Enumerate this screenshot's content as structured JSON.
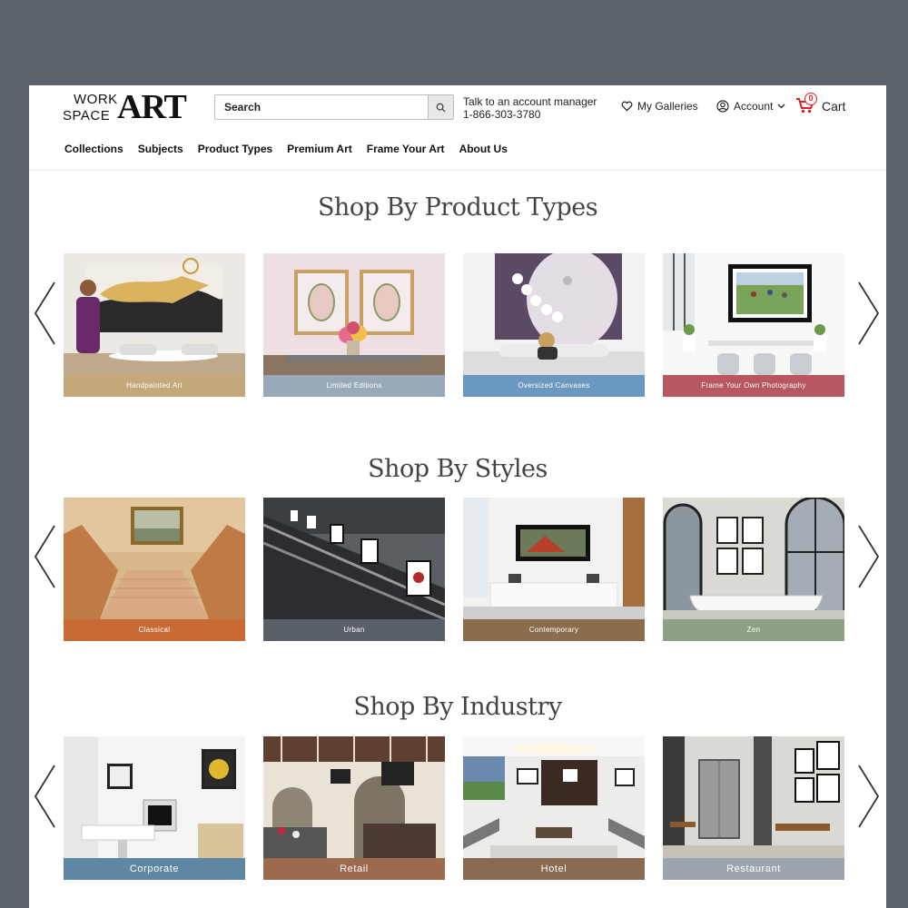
{
  "header": {
    "logo_work": "WORK",
    "logo_space": "SPACE",
    "logo_art": "ART",
    "search_placeholder": "Search",
    "contact_line1": "Talk to an account manager",
    "contact_line2": "1-866-303-3780",
    "galleries_label": "My Galleries",
    "account_label": "Account",
    "cart_label": "Cart",
    "cart_count": "0"
  },
  "nav": [
    "Collections",
    "Subjects",
    "Product Types",
    "Premium Art",
    "Frame Your Art",
    "About Us"
  ],
  "sections": {
    "product_types": {
      "title": "Shop By Product Types",
      "cards": [
        {
          "label": "Handpainted Art",
          "color": "#c3a97a"
        },
        {
          "label": "Limited Editions",
          "color": "#9aa9b8"
        },
        {
          "label": "Oversized Canvases",
          "color": "#6b98bf"
        },
        {
          "label": "Frame Your Own Photography",
          "color": "#b8575f"
        }
      ]
    },
    "styles": {
      "title": "Shop By Styles",
      "cards": [
        {
          "label": "Classical",
          "color": "#c86b35"
        },
        {
          "label": "Urban",
          "color": "#5a6067"
        },
        {
          "label": "Contemporary",
          "color": "#8b6d4e"
        },
        {
          "label": "Zen",
          "color": "#8ea086"
        }
      ]
    },
    "industry": {
      "title": "Shop By Industry",
      "cards": [
        {
          "label": "Corporate",
          "color": "#5e87a4"
        },
        {
          "label": "Retail",
          "color": "#9c6a4c"
        },
        {
          "label": "Hotel",
          "color": "#8a6b52"
        },
        {
          "label": "Restaurant",
          "color": "#9ba4af"
        }
      ]
    }
  }
}
